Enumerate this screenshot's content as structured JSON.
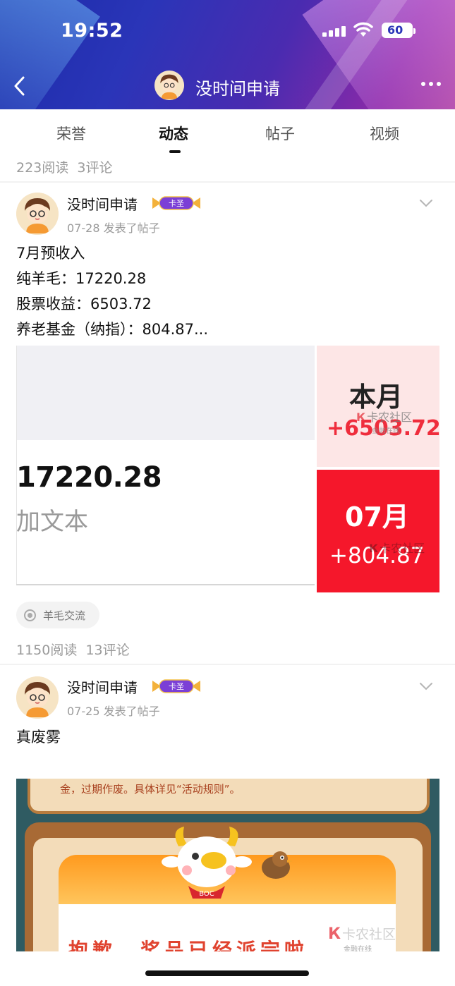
{
  "status_bar": {
    "time": "19:52",
    "battery": "60"
  },
  "nav": {
    "title": "没时间申请"
  },
  "tabs": [
    {
      "label": "荣誉"
    },
    {
      "label": "动态"
    },
    {
      "label": "帖子"
    },
    {
      "label": "视频"
    }
  ],
  "active_tab": "动态",
  "top_stats": {
    "reads": "223阅读",
    "comments": "3评论"
  },
  "posts": [
    {
      "author": "没时间申请",
      "badge": "卡圣",
      "date": "07-28 发表了帖子",
      "lines": [
        "7月预收入",
        "纯羊毛：17220.28",
        "股票收益：6503.72",
        "养老基金（纳指）：804.87..."
      ],
      "image": {
        "main_value": "17220.28",
        "sub_text": "加文本",
        "box_top_label": "本月",
        "box_top_value": "+6503.72",
        "box_bottom_label": "07月",
        "box_bottom_value": "+804.87",
        "watermark": "卡农社区",
        "watermark_sub": "金融在线"
      },
      "tag": "羊毛交流",
      "reads": "1150阅读",
      "comments": "13评论"
    },
    {
      "author": "没时间申请",
      "badge": "卡圣",
      "date": "07-25 发表了帖子",
      "lines": [
        "真废雾"
      ],
      "image": {
        "top_text": "金，过期作废。具体详见“活动规则”。",
        "cow_label": "BOC",
        "bottom_text": "抱歉，奖品已经派完啦",
        "watermark": "卡农社区",
        "watermark_sub": "金融在线"
      }
    }
  ],
  "colors": {
    "accent_red": "#f5172b",
    "header_blue": "#2a35b8",
    "header_purple": "#8a2aa8"
  }
}
